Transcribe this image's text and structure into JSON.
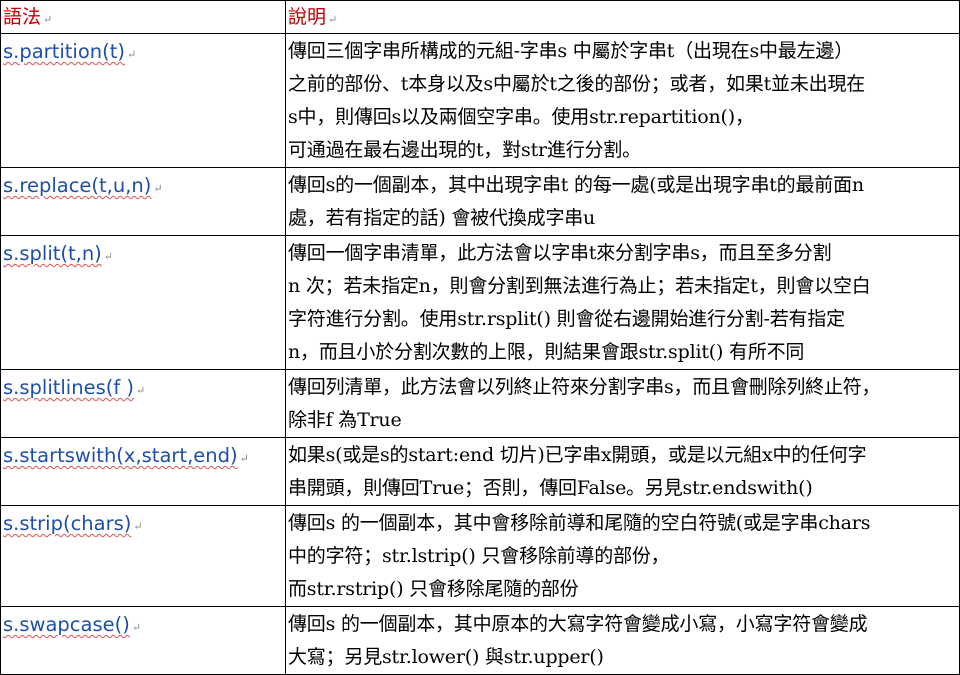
{
  "header": {
    "syntax": "語法",
    "description": "說明"
  },
  "rows": [
    {
      "syntax": "s.partition(t)",
      "lines": [
        "傳回三個字串所構成的元組-字串s 中屬於字串t（出現在s中最左邊）",
        "之前的部份、t本身以及s中屬於t之後的部份；或者，如果t並未出現在",
        "s中，則傳回s以及兩個空字串。使用str.repartition()，",
        "可通過在最右邊出現的t，對str進行分割。"
      ]
    },
    {
      "syntax": "s.replace(t,u,n)",
      "lines": [
        "傳回s的一個副本，其中出現字串t 的每一處(或是出現字串t的最前面n",
        "處，若有指定的話) 會被代換成字串u"
      ]
    },
    {
      "syntax": "s.split(t,n)",
      "lines": [
        "傳回一個字串清單，此方法會以字串t來分割字串s，而且至多分割",
        "n 次；若未指定n，則會分割到無法進行為止；若未指定t，則會以空白",
        "字符進行分割。使用str.rsplit() 則會從右邊開始進行分割-若有指定",
        "n，而且小於分割次數的上限，則結果會跟str.split() 有所不同"
      ]
    },
    {
      "syntax": "s.splitlines(f )",
      "lines": [
        "傳回列清單，此方法會以列終止符來分割字串s，而且會刪除列終止符，",
        "除非f 為True"
      ]
    },
    {
      "syntax": "s.startswith(x,start,end)",
      "lines": [
        "如果s(或是s的start:end 切片)已字串x開頭，或是以元組x中的任何字",
        "串開頭，則傳回True；否則，傳回False。另見str.endswith()"
      ]
    },
    {
      "syntax": "s.strip(chars)",
      "lines": [
        "傳回s 的一個副本，其中會移除前導和尾隨的空白符號(或是字串chars",
        "中的字符；str.lstrip() 只會移除前導的部份，",
        "而str.rstrip() 只會移除尾隨的部份"
      ]
    },
    {
      "syntax": "s.swapcase()",
      "lines": [
        "傳回s 的一個副本，其中原本的大寫字符會變成小寫，小寫字符會變成",
        "大寫；另見str.lower() 與str.upper()"
      ]
    }
  ],
  "paragraph_mark": "↵"
}
